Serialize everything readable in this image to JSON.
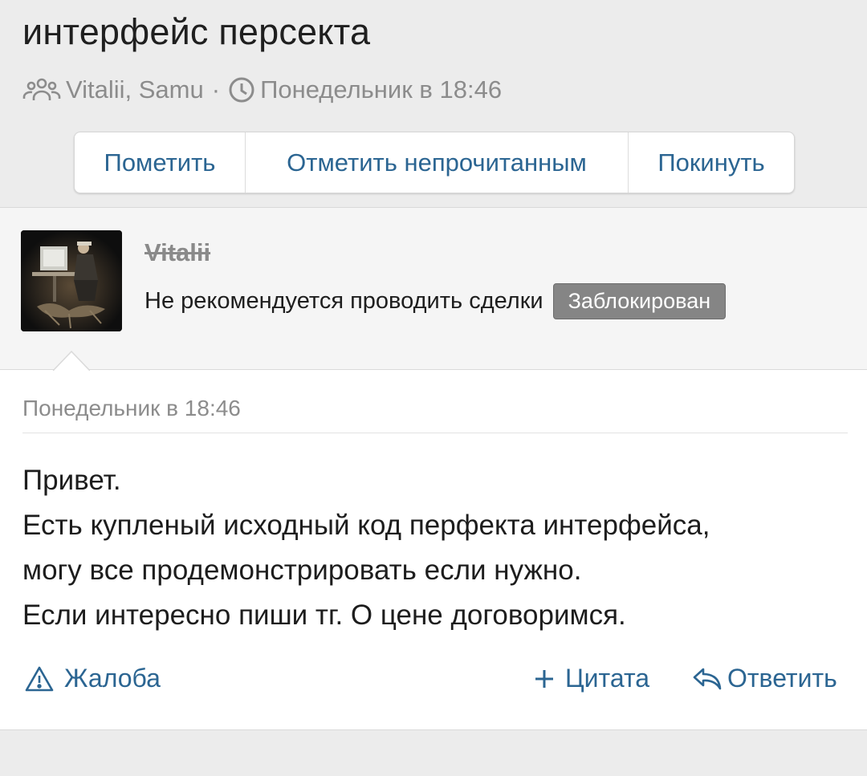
{
  "thread": {
    "title": "интерфейс персекта",
    "participants": "Vitalii, Samu",
    "separator": "·",
    "date": "Понедельник в 18:46",
    "buttons": {
      "mark": "Пометить",
      "mark_unread": "Отметить непрочитанным",
      "leave": "Покинуть"
    }
  },
  "message": {
    "author": "Vitalii",
    "user_title": "Не рекомендуется проводить сделки",
    "badge": "Заблокирован",
    "date": "Понедельник в 18:46",
    "body_lines": [
      "Привет.",
      "Есть купленый исходный код перфекта интерфейса,",
      "могу все продемонстрировать если нужно.",
      "Если интересно пиши тг. О цене договоримся."
    ],
    "actions": {
      "report": "Жалоба",
      "quote": "Цитата",
      "reply": "Ответить"
    }
  },
  "icons": {
    "participants": "users-icon",
    "time": "clock-icon",
    "report": "warning-icon",
    "quote": "plus-icon",
    "reply": "reply-icon"
  },
  "colors": {
    "accent": "#2b6592",
    "muted": "#8c8c8c",
    "badge": "#858585"
  }
}
